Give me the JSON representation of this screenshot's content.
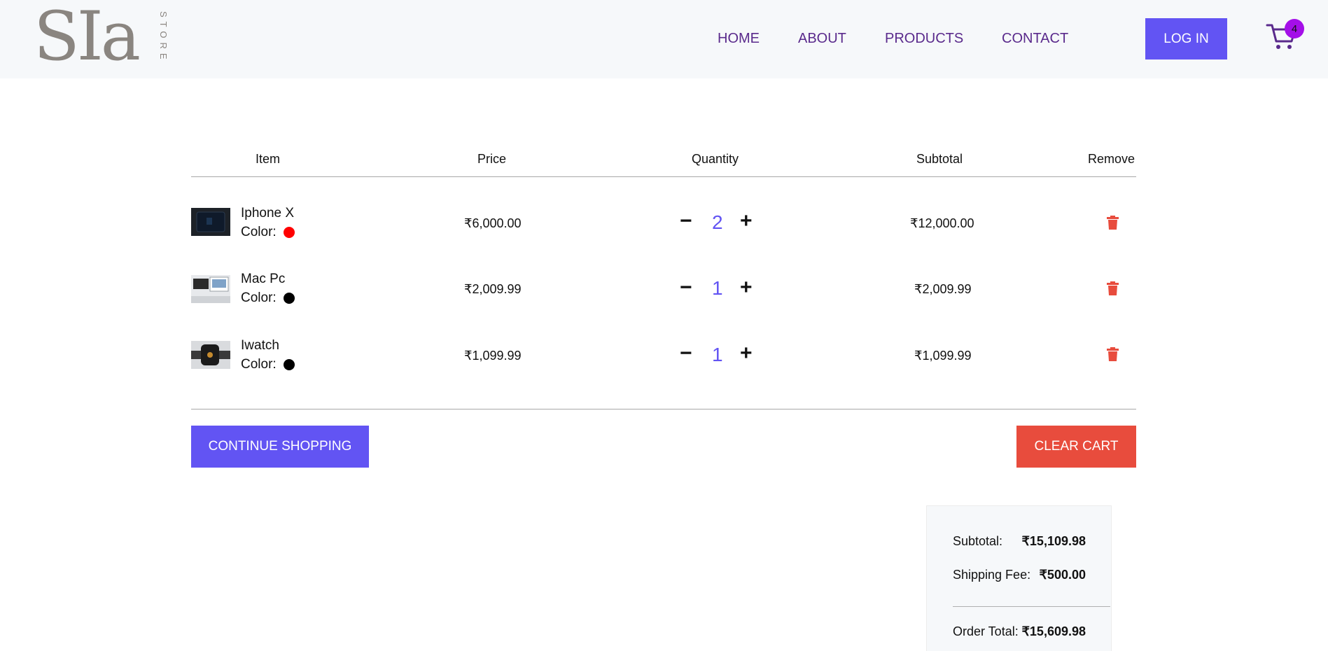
{
  "brand": {
    "logo_main": "SIa",
    "logo_side": "STORE"
  },
  "nav": [
    {
      "label": "HOME"
    },
    {
      "label": "ABOUT"
    },
    {
      "label": "PRODUCTS"
    },
    {
      "label": "CONTACT"
    }
  ],
  "header": {
    "login_label": "LOG IN",
    "cart_count": "4"
  },
  "table": {
    "headers": [
      "Item",
      "Price",
      "Quantity",
      "Subtotal",
      "Remove"
    ],
    "rows": [
      {
        "name": "Iphone X",
        "color_label": "Color:",
        "color": "#ff0000",
        "price": "₹6,000.00",
        "quantity": "2",
        "subtotal": "₹12,000.00"
      },
      {
        "name": "Mac Pc",
        "color_label": "Color:",
        "color": "#000000",
        "price": "₹2,009.99",
        "quantity": "1",
        "subtotal": "₹2,009.99"
      },
      {
        "name": "Iwatch",
        "color_label": "Color:",
        "color": "#000000",
        "price": "₹1,099.99",
        "quantity": "1",
        "subtotal": "₹1,099.99"
      }
    ]
  },
  "qty_controls": {
    "minus": "−",
    "plus": "+"
  },
  "actions": {
    "continue_label": "CONTINUE SHOPPING",
    "clear_label": "CLEAR CART"
  },
  "summary": {
    "subtotal_label": "Subtotal:",
    "subtotal_value": "₹15,109.98",
    "shipping_label": "Shipping Fee:",
    "shipping_value": "₹500.00",
    "total_label": "Order Total:",
    "total_value": "₹15,609.98"
  },
  "colors": {
    "accent": "#6254f3",
    "danger": "#e84c3d",
    "nav_text": "#5a2a8c",
    "badge": "#a40fe8"
  }
}
